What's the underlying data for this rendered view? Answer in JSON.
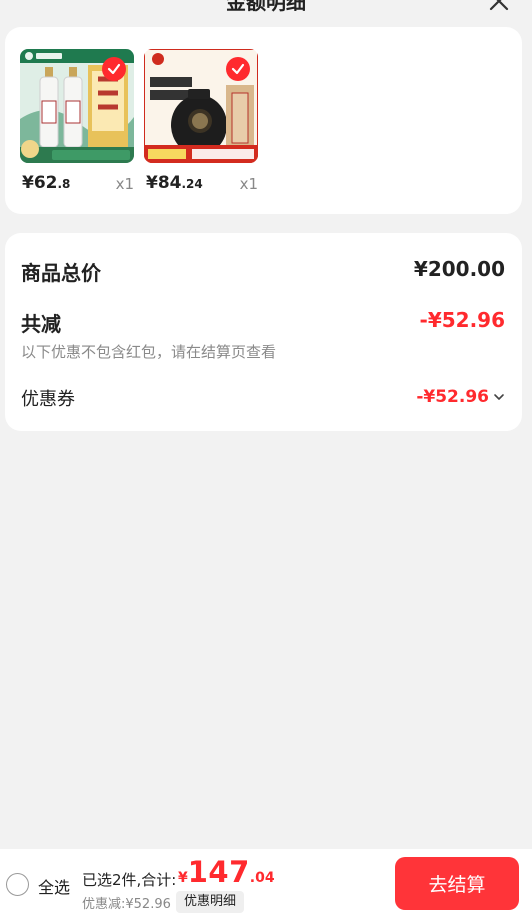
{
  "header": {
    "title": "金额明细",
    "close_icon": "close-icon"
  },
  "products": [
    {
      "price_int": "¥62",
      "price_dec": ".8",
      "qty": "x1",
      "selected": true
    },
    {
      "price_int": "¥84",
      "price_dec": ".24",
      "qty": "x1",
      "selected": true
    }
  ],
  "summary": {
    "total_label": "商品总价",
    "total_value": "¥200.00",
    "reduce_label": "共减",
    "reduce_value": "-¥52.96",
    "note": "以下优惠不包含红包，请在结算页查看",
    "coupon_label": "优惠券",
    "coupon_value": "-¥52.96"
  },
  "footer": {
    "select_all": "全选",
    "selected_info": "已选2件,合计:",
    "total_symbol": "¥",
    "total_int": "147",
    "total_dec": ".04",
    "discount_info": "优惠减:¥52.96",
    "detail_button": "优惠明细",
    "checkout_button": "去结算"
  },
  "colors": {
    "accent": "#ff2a2e",
    "background": "#f2f2f2"
  }
}
